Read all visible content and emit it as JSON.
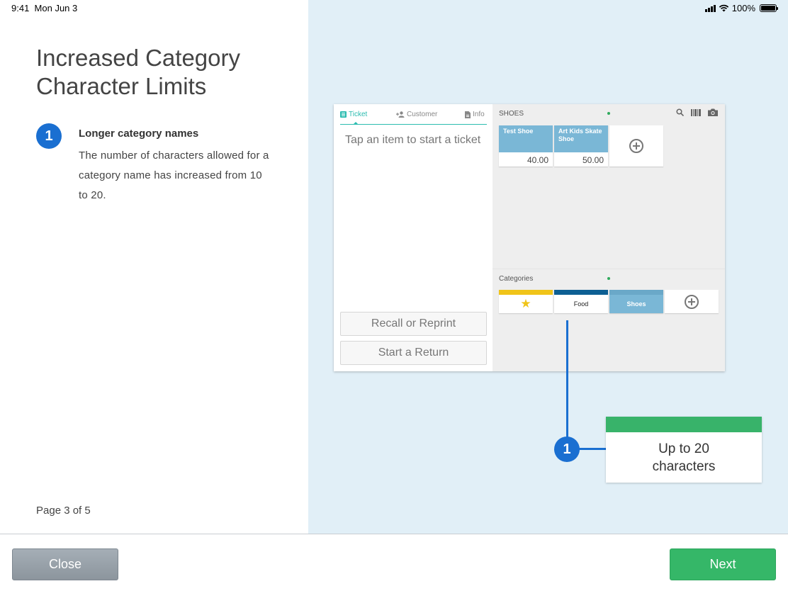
{
  "status_bar": {
    "time": "9:41",
    "date": "Mon Jun 3",
    "battery": "100%",
    "battery_level": 1.0
  },
  "left": {
    "title": "Increased Category Character Limits",
    "feature": {
      "number": "1",
      "title": "Longer category names",
      "description": "The number of characters allowed for a category name has increased from 10 to 20."
    },
    "page_indicator": "Page 3 of 5"
  },
  "mock": {
    "tabs": [
      {
        "label": "Ticket",
        "icon": "list-icon",
        "active": true
      },
      {
        "label": "Customer",
        "icon": "add-person-icon",
        "active": false
      },
      {
        "label": "Info",
        "icon": "document-icon",
        "active": false
      }
    ],
    "tap_hint": "Tap an item to start a ticket",
    "recall_button": "Recall or Reprint",
    "return_button": "Start a Return",
    "section_label": "SHOES",
    "items": [
      {
        "name": "Test Shoe",
        "price": "40.00"
      },
      {
        "name": "Art Kids Skate Shoe",
        "price": "50.00"
      }
    ],
    "categories_label": "Categories",
    "categories": [
      {
        "label": "★",
        "color": "#f0c419",
        "selected": false
      },
      {
        "label": "Food",
        "color": "#0d5f93",
        "selected": false
      },
      {
        "label": "Shoes",
        "color": "#7ab7d6",
        "selected": true
      }
    ]
  },
  "callout": {
    "number": "1",
    "text": "Up to 20 characters"
  },
  "footer": {
    "close_label": "Close",
    "next_label": "Next"
  },
  "colors": {
    "accent_blue": "#1a6fd1",
    "green": "#35b768",
    "teal": "#2cbcb0",
    "panel_bg": "#e1eff7"
  }
}
